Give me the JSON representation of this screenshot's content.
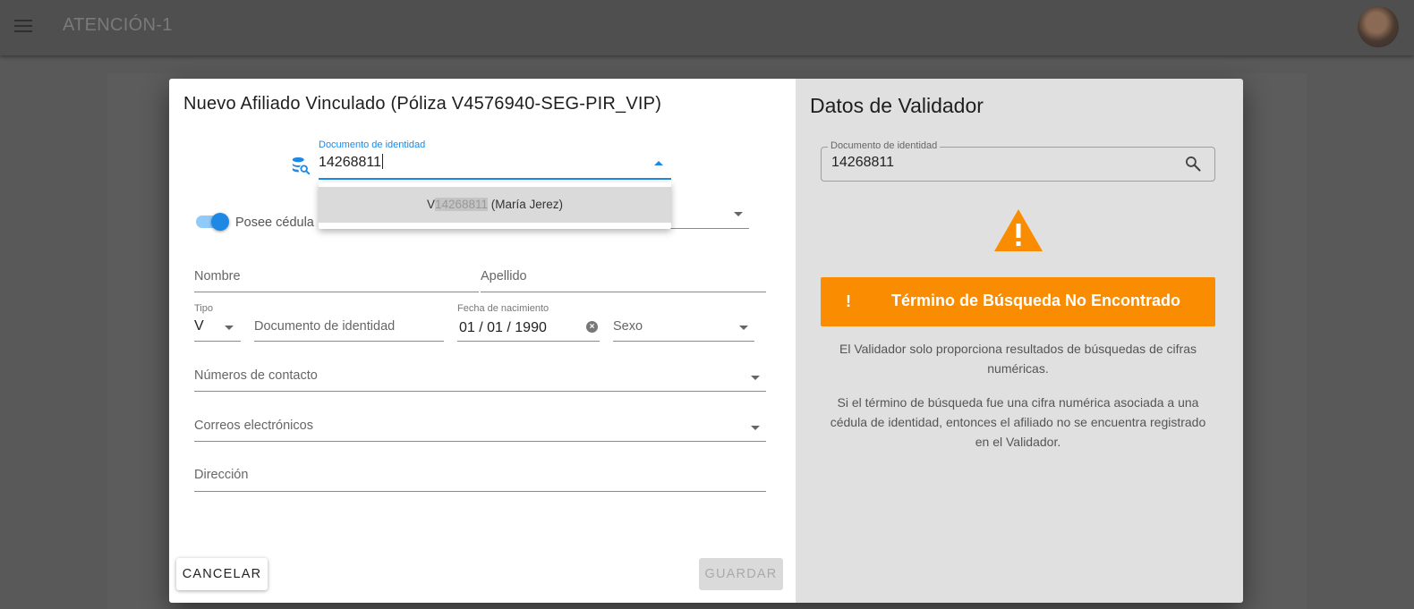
{
  "appbar": {
    "title": "ATENCIÓN-1",
    "menu_icon": "hamburger-menu-icon",
    "avatar": "user-avatar"
  },
  "dialog": {
    "title": "Nuevo Afiliado Vinculado (Póliza V4576940-SEG-PIR_VIP)",
    "doc_search": {
      "label": "Documento de identidad",
      "value": "14268811",
      "icon": "database-search-icon"
    },
    "autocomplete": {
      "prefix": "V",
      "match": "14268811",
      "suffix": " (María Jerez)"
    },
    "toggle": {
      "label": "Posee cédula",
      "checked": true
    },
    "fields": {
      "nombre": "Nombre",
      "apellido": "Apellido",
      "tipo_label": "Tipo",
      "tipo_value": "V",
      "documento": "Documento de identidad",
      "fecha_label": "Fecha de nacimiento",
      "fecha_value": "01 / 01 / 1990",
      "sexo": "Sexo",
      "contacto": "Números de contacto",
      "correos": "Correos electrónicos",
      "direccion": "Dirección"
    },
    "buttons": {
      "cancel": "CANCELAR",
      "save": "GUARDAR"
    }
  },
  "validator": {
    "title": "Datos de Validador",
    "doc_label": "Documento de identidad",
    "doc_value": "14268811",
    "alert_bang": "!",
    "alert_text": "Término de Búsqueda No Encontrado",
    "alert_color": "#f98c00",
    "paragraph_1": "El Validador solo proporciona resultados de búsquedas de cifras numéricas.",
    "paragraph_2": "Si el término de búsqueda fue una cifra numérica asociada a una cédula de identidad, entonces el afiliado no se encuentra registrado en el Validador."
  },
  "colors": {
    "primary": "#1e88e5",
    "warning": "#f98c00"
  }
}
